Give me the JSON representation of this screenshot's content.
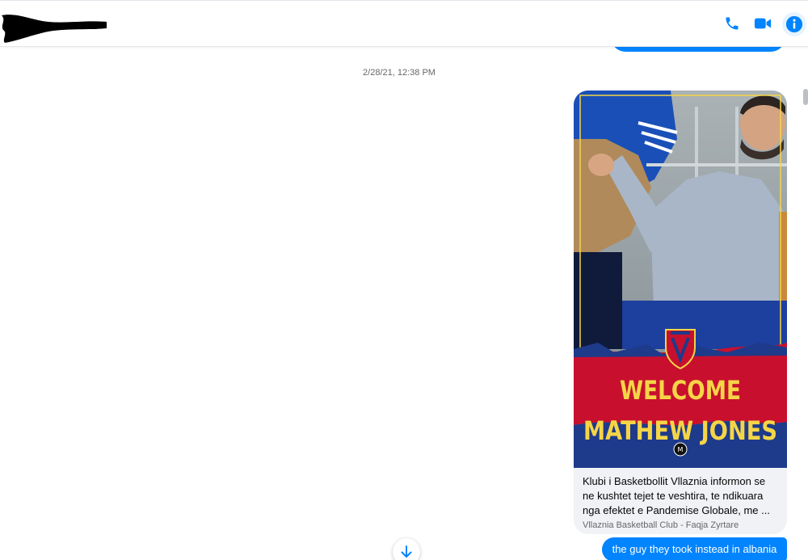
{
  "header": {
    "phone_icon": "phone-icon",
    "video_icon": "video-camera-icon",
    "info_icon": "info-icon"
  },
  "conversation": {
    "timestamp": "2/28/21, 12:38 PM",
    "link_card": {
      "image_caption_line1": "WELCOME",
      "image_caption_line2": "MATHEW JONES",
      "description": "Klubi i Basketbollit Vllaznia informon se ne kushtet tejet te veshtira, te ndikuara nga efektet e Pandemise Globale, me ...",
      "source": "Vllaznia Basketball Club - Faqja Zyrtare"
    },
    "reply_text": "the guy they took instead in albania"
  },
  "colors": {
    "accent": "#0084ff",
    "card_bg": "#f0f2f5",
    "banner_red": "#c8102e",
    "banner_navy": "#1e3a8a",
    "banner_yellow": "#f5d547"
  }
}
